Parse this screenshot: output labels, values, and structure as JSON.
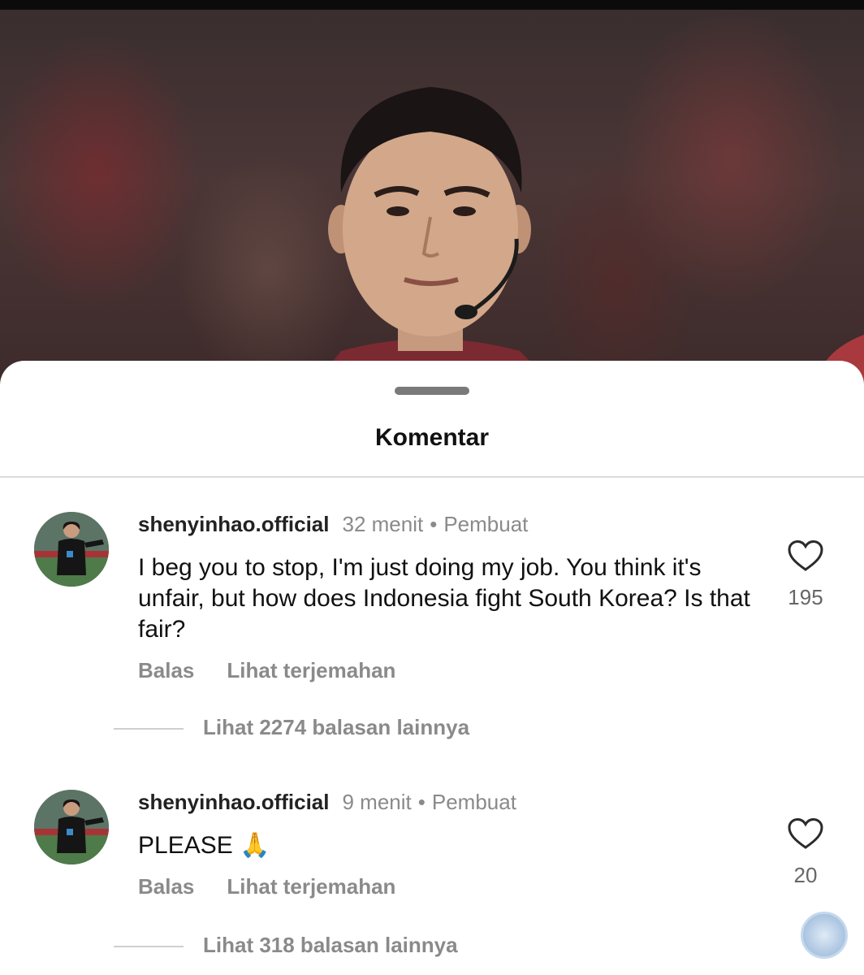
{
  "sheet": {
    "title": "Komentar"
  },
  "comments": [
    {
      "username": "shenyinhao.official",
      "time": "32 menit",
      "separator": "•",
      "role": "Pembuat",
      "text": "I beg you to stop, I'm just doing my job. You think it's unfair, but how does Indonesia fight South Korea? Is that fair?",
      "reply_label": "Balas",
      "translate_label": "Lihat terjemahan",
      "like_count": "195",
      "replies_label": "Lihat 2274 balasan lainnya"
    },
    {
      "username": "shenyinhao.official",
      "time": "9 menit",
      "separator": "•",
      "role": "Pembuat",
      "text": "PLEASE 🙏",
      "reply_label": "Balas",
      "translate_label": "Lihat terjemahan",
      "like_count": "20",
      "replies_label": "Lihat 318 balasan lainnya"
    }
  ],
  "icons": {
    "like": "heart-icon",
    "handle": "drag-handle",
    "badge": "watermark-badge"
  }
}
